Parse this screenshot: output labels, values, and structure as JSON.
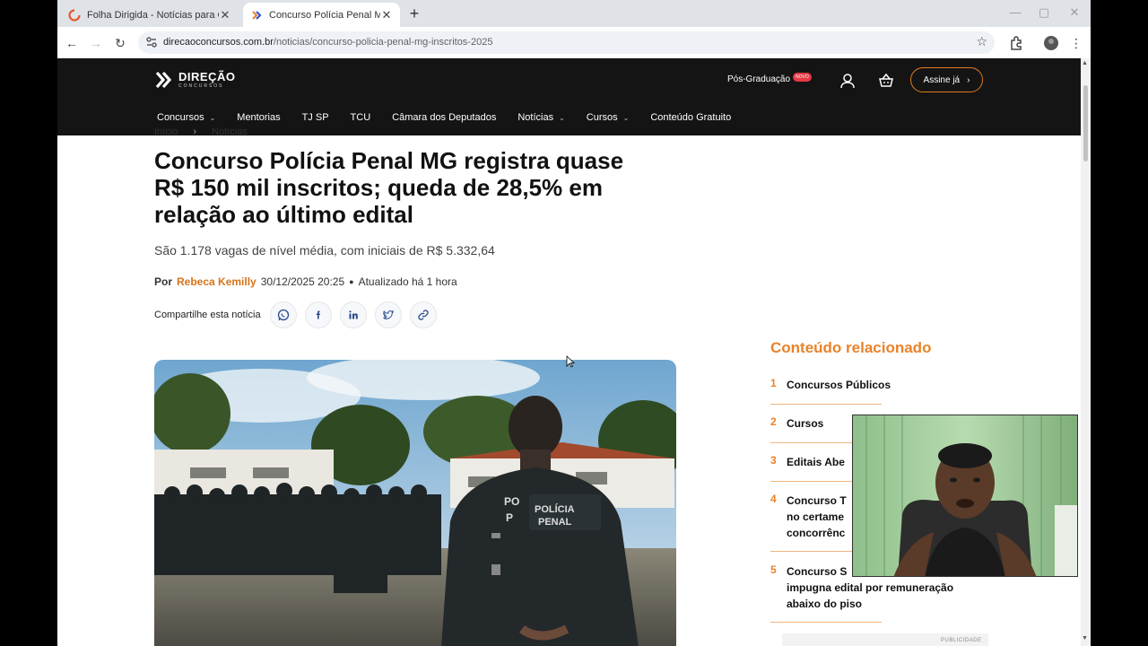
{
  "browser": {
    "tabs": [
      {
        "title": "Folha Dirigida - Notícias para C",
        "active": false
      },
      {
        "title": "Concurso Polícia Penal MG regi",
        "active": true
      }
    ],
    "url_host": "direcaoconcursos.com.br",
    "url_path": "/noticias/concurso-policia-penal-mg-inscritos-2025"
  },
  "site": {
    "logo_name": "DIREÇÃO",
    "logo_sub": "CONCURSOS",
    "pos_graduacao": "Pós-Graduação",
    "novo_badge": "NOVO",
    "assine": "Assine já",
    "nav": [
      {
        "label": "Concursos",
        "has_dropdown": true
      },
      {
        "label": "Mentorias",
        "has_dropdown": false
      },
      {
        "label": "TJ SP",
        "has_dropdown": false
      },
      {
        "label": "TCU",
        "has_dropdown": false
      },
      {
        "label": "Câmara dos Deputados",
        "has_dropdown": false
      },
      {
        "label": "Notícias",
        "has_dropdown": true
      },
      {
        "label": "Cursos",
        "has_dropdown": true
      },
      {
        "label": "Conteúdo Gratuito",
        "has_dropdown": false
      }
    ]
  },
  "article": {
    "breadcrumb_home": "Início",
    "breadcrumb_sep": "›",
    "breadcrumb_section": "Notícias",
    "headline": "Concurso Polícia Penal MG registra quase R$ 150 mil inscritos; queda de 28,5% em relação ao último edital",
    "subhead": "São 1.178 vagas de nível média, com iniciais de R$ 5.332,64",
    "by_label": "Por",
    "author": "Rebeca Kemilly",
    "datetime": "30/12/2025 20:25",
    "updated": "Atualizado há 1 hora",
    "share_label": "Compartilhe esta notícia",
    "share_buttons": [
      "whatsapp-icon",
      "facebook-icon",
      "linkedin-icon",
      "twitter-icon",
      "link-icon"
    ],
    "hero_badge_text": "POLÍCIA PENAL",
    "hero_badge_side": "PO P"
  },
  "sidebar": {
    "title": "Conteúdo relacionado",
    "items": [
      {
        "num": "1",
        "title": "Concursos Públicos"
      },
      {
        "num": "2",
        "title": "Cursos"
      },
      {
        "num": "3",
        "title": "Editais Abe"
      },
      {
        "num": "4",
        "title": "Concurso T\nno certame\nconcorrênc"
      },
      {
        "num": "5",
        "title": "Concurso S\nimpugna edital por remuneração\nabaixo do piso"
      }
    ],
    "ad_label": "PUBLICIDADE"
  },
  "colors": {
    "accent_orange": "#e8832a",
    "header_bg": "#141414",
    "headline": "#111111"
  }
}
